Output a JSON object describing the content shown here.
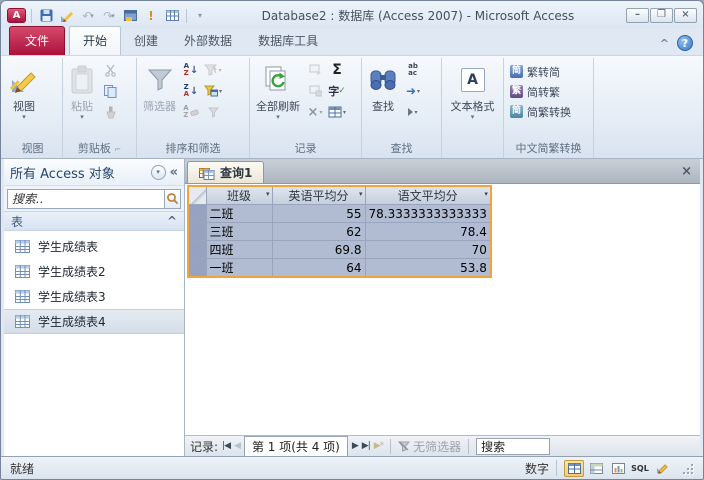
{
  "window": {
    "title": "Database2 : 数据库 (Access 2007)  -  Microsoft Access"
  },
  "icons": {
    "access_logo": "A",
    "undo": "↶",
    "redo": "↷",
    "dropdown": "▾",
    "exclamation": "!",
    "minimize": "–",
    "restore": "❐",
    "close": "×",
    "collapse_ribbon": "^",
    "help": "?",
    "sigma": "Σ",
    "spell_char": "字",
    "spell_check": "✓",
    "delete_x": "×",
    "nav_dropdown": "▾",
    "nav_collapse": "«",
    "section_collapse": "^",
    "doc_close": "×",
    "bar": "|",
    "arrow_left": "◀",
    "arrow_right": "▶",
    "new_star": "*",
    "sort_a": "A",
    "sort_z": "Z",
    "replace_ab": "ab",
    "replace_ac": "ac",
    "goto_arrow": "➜",
    "text_format_a": "A",
    "sql": "SQL",
    "cn_jian": "简",
    "cn_fan": "繁"
  },
  "ribbon_tabs": {
    "file": "文件",
    "home": "开始",
    "create": "创建",
    "external": "外部数据",
    "dbtools": "数据库工具"
  },
  "ribbon": {
    "view": {
      "label": "视图",
      "button": "视图"
    },
    "clipboard": {
      "label": "剪贴板",
      "paste": "粘贴"
    },
    "sort_filter": {
      "label": "排序和筛选",
      "filter": "筛选器"
    },
    "records": {
      "label": "记录",
      "refresh_all": "全部刷新"
    },
    "find": {
      "label": "查找",
      "find": "查找"
    },
    "text_format": {
      "label": "",
      "button": "文本格式"
    },
    "chinese": {
      "label": "中文简繁转换",
      "items": [
        "繁转简",
        "简转繁",
        "简繁转换"
      ]
    }
  },
  "nav": {
    "header": "所有 Access 对象",
    "search_placeholder": "搜索..",
    "section": "表",
    "items": [
      {
        "label": "学生成绩表"
      },
      {
        "label": "学生成绩表2"
      },
      {
        "label": "学生成绩表3"
      },
      {
        "label": "学生成绩表4"
      }
    ],
    "selected": "学生成绩表4"
  },
  "document": {
    "tab": "查询1"
  },
  "datasheet": {
    "columns": [
      "班级",
      "英语平均分",
      "语文平均分"
    ],
    "rows": [
      [
        "二班",
        "55",
        "78.3333333333333"
      ],
      [
        "三班",
        "62",
        "78.4"
      ],
      [
        "四班",
        "69.8",
        "70"
      ],
      [
        "一班",
        "64",
        "53.8"
      ]
    ]
  },
  "record_bar": {
    "label": "记录:",
    "position": "第 1 项(共 4 项)",
    "no_filter": "无筛选器",
    "search": "搜索"
  },
  "status_bar": {
    "left": "就绪",
    "num_lock": "数字"
  },
  "colors": {
    "accent_selection_border": "#efa53c",
    "selection_fill": "#b1bcd3",
    "file_tab": "#ab123d",
    "status_view_active": "#f8cd6e"
  }
}
